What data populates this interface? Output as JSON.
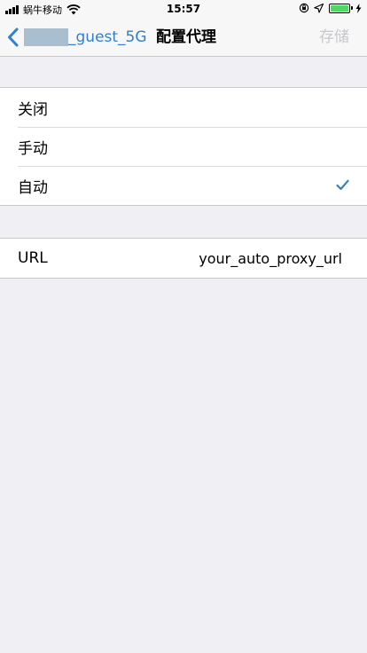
{
  "status_bar": {
    "carrier": "蜗牛移动",
    "time": "15:57"
  },
  "nav": {
    "back_label": "_guest_5G",
    "title": "配置代理",
    "save_label": "存储"
  },
  "proxy_options": [
    {
      "label": "关闭",
      "selected": false
    },
    {
      "label": "手动",
      "selected": false
    },
    {
      "label": "自动",
      "selected": true
    }
  ],
  "url_field": {
    "label": "URL",
    "value": "your_auto_proxy_url"
  },
  "colors": {
    "accent": "#2f7fd4",
    "background": "#efeff4",
    "battery": "#4cd964",
    "disabled": "#c7c7cc"
  }
}
